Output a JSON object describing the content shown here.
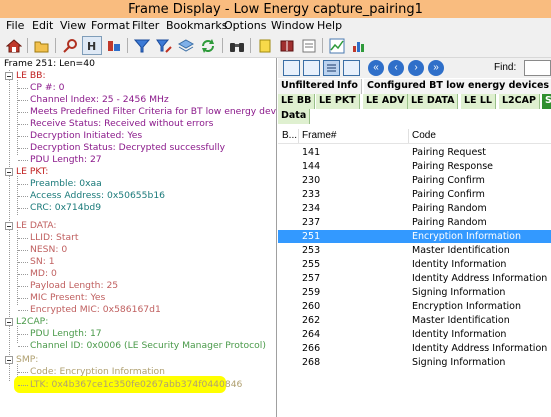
{
  "window": {
    "title": "Frame Display - Low Energy capture_pairing1"
  },
  "menu": [
    "File",
    "Edit",
    "View",
    "Format",
    "Filter",
    "Bookmarks",
    "Options",
    "Window",
    "Help"
  ],
  "tree": {
    "header": "Frame 251:  Len=40",
    "sections": [
      {
        "label": "LE BB:",
        "color": "#c02020",
        "fields": [
          "CP #: 0",
          "Channel Index: 25 - 2456 MHz",
          "Meets Predefined Filter Criteria for BT low energy devices: N",
          "Receive Status: Received without errors",
          "Decryption Initiated: Yes",
          "Decryption Status: Decrypted successfully",
          "PDU Length: 27"
        ],
        "field_color": "#8b1a8b"
      },
      {
        "label": "LE PKT:",
        "color": "#c02020",
        "fields": [
          "Preamble: 0xaa",
          "Access Address: 0x50655b16",
          "CRC: 0x714bd9"
        ],
        "field_color": "#1a7a7a"
      },
      {
        "label": "LE DATA:",
        "color": "#c06060",
        "fields": [
          "LLID: Start",
          "NESN: 0",
          "SN: 1",
          "MD: 0",
          "Payload Length: 25",
          "MIC Present: Yes",
          "Encrypted MIC: 0x586167d1"
        ],
        "field_color": "#c06060"
      },
      {
        "label": "L2CAP:",
        "color": "#4a9a4a",
        "fields": [
          "PDU Length: 17",
          "Channel ID: 0x0006  (LE Security Manager Protocol)"
        ],
        "field_color": "#4a9a4a"
      },
      {
        "label": "SMP:",
        "color": "#b0a070",
        "fields": [
          "Code: Encryption Information",
          "LTK: 0x4b367ce1c350fe0267abb374f0440846"
        ],
        "field_color": "#b0a070"
      }
    ]
  },
  "right": {
    "find_label": "Find:",
    "tabs_row1": [
      "Unfiltered",
      "Info",
      "Configured BT low energy devices"
    ],
    "tabs_row2": [
      "LE BB",
      "LE PKT",
      "LE ADV",
      "LE DATA",
      "LE LL",
      "L2CAP",
      "S"
    ],
    "tabs_row3": [
      "Data"
    ],
    "columns": {
      "bookmark": "B...",
      "frame": "Frame#",
      "code": "Code"
    },
    "rows": [
      {
        "frame": "141",
        "code": "Pairing Request"
      },
      {
        "frame": "144",
        "code": "Pairing Response"
      },
      {
        "frame": "230",
        "code": "Pairing Confirm"
      },
      {
        "frame": "233",
        "code": "Pairing Confirm"
      },
      {
        "frame": "234",
        "code": "Pairing Random"
      },
      {
        "frame": "237",
        "code": "Pairing Random"
      },
      {
        "frame": "251",
        "code": "Encryption Information",
        "selected": true
      },
      {
        "frame": "253",
        "code": "Master Identification"
      },
      {
        "frame": "255",
        "code": "Identity Information"
      },
      {
        "frame": "257",
        "code": "Identity Address Information"
      },
      {
        "frame": "259",
        "code": "Signing Information"
      },
      {
        "frame": "260",
        "code": "Encryption Information"
      },
      {
        "frame": "262",
        "code": "Master Identification"
      },
      {
        "frame": "264",
        "code": "Identity Information"
      },
      {
        "frame": "266",
        "code": "Identity Address Information"
      },
      {
        "frame": "268",
        "code": "Signing Information"
      }
    ]
  },
  "toolbar_icons": [
    "home-icon",
    "open-folder-icon",
    "search-icon",
    "hex-view-icon",
    "colors-icon",
    "filter-icon",
    "filter-edit-icon",
    "layers-icon",
    "refresh-icon",
    "binoculars-icon",
    "bookmark-icon",
    "book-icon",
    "notes-icon",
    "chart-icon",
    "bar-chart-icon"
  ],
  "colors": {
    "titlebar": "#f9bc7f",
    "selection": "#3399ff",
    "highlight": "#ffff00"
  }
}
